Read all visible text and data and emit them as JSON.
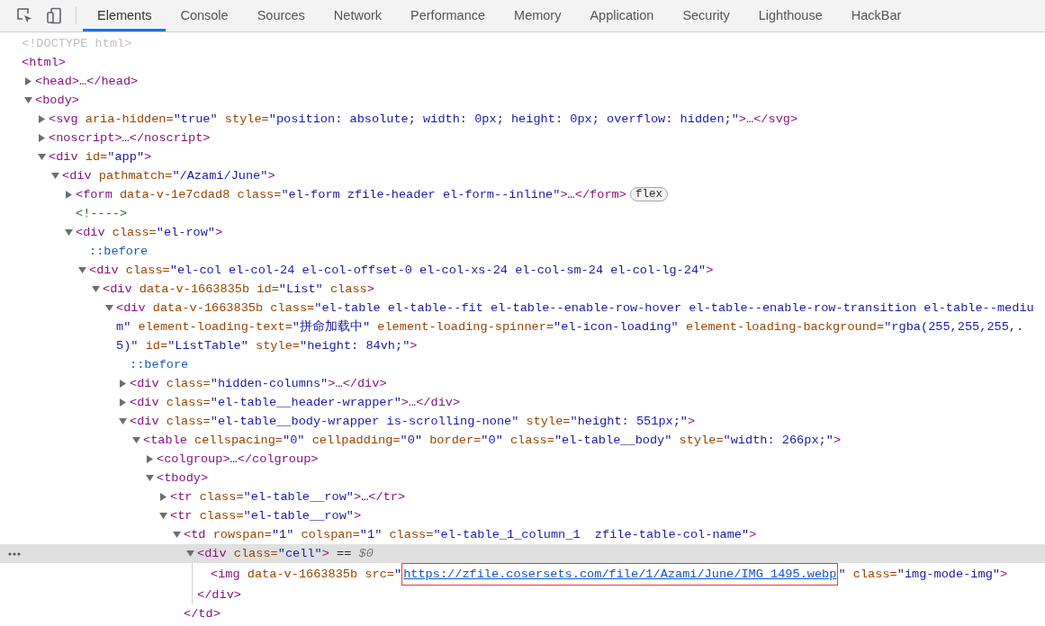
{
  "toolbar": {
    "tabs": [
      {
        "label": "Elements",
        "selected": true
      },
      {
        "label": "Console",
        "selected": false
      },
      {
        "label": "Sources",
        "selected": false
      },
      {
        "label": "Network",
        "selected": false
      },
      {
        "label": "Performance",
        "selected": false
      },
      {
        "label": "Memory",
        "selected": false
      },
      {
        "label": "Application",
        "selected": false
      },
      {
        "label": "Security",
        "selected": false
      },
      {
        "label": "Lighthouse",
        "selected": false
      },
      {
        "label": "HackBar",
        "selected": false
      }
    ]
  },
  "dom_tree": [
    {
      "selected": false,
      "tokens": [
        {
          "kind": "doctype",
          "text": "<!DOCTYPE html>"
        }
      ]
    },
    {
      "selected": false,
      "tokens": [
        {
          "kind": "tag",
          "text": "<html>"
        }
      ],
      "children": [
        {
          "selected": false,
          "expanded": false,
          "tokens": [
            {
              "kind": "tag",
              "text": "<head>"
            },
            {
              "kind": "plain",
              "text": "…"
            },
            {
              "kind": "tag",
              "text": "</head>"
            }
          ]
        },
        {
          "selected": false,
          "expanded": true,
          "tokens": [
            {
              "kind": "tag",
              "text": "<body>"
            }
          ],
          "children": [
            {
              "selected": false,
              "expanded": false,
              "tokens": [
                {
                  "kind": "tag",
                  "text": "<svg"
                },
                {
                  "kind": "attr",
                  "text": " aria-hidden="
                },
                {
                  "kind": "value",
                  "text": "\"true\""
                },
                {
                  "kind": "attr",
                  "text": " style="
                },
                {
                  "kind": "value",
                  "text": "\"position: absolute; width: 0px; height: 0px; overflow: hidden;\""
                },
                {
                  "kind": "tag",
                  "text": ">"
                },
                {
                  "kind": "plain",
                  "text": "…"
                },
                {
                  "kind": "tag",
                  "text": "</svg>"
                }
              ]
            },
            {
              "selected": false,
              "expanded": false,
              "tokens": [
                {
                  "kind": "tag",
                  "text": "<noscript>"
                },
                {
                  "kind": "plain",
                  "text": "…"
                },
                {
                  "kind": "tag",
                  "text": "</noscript>"
                }
              ]
            },
            {
              "selected": false,
              "expanded": true,
              "tokens": [
                {
                  "kind": "tag",
                  "text": "<div"
                },
                {
                  "kind": "attr",
                  "text": " id="
                },
                {
                  "kind": "value",
                  "text": "\"app\""
                },
                {
                  "kind": "tag",
                  "text": ">"
                }
              ],
              "children": [
                {
                  "selected": false,
                  "expanded": true,
                  "tokens": [
                    {
                      "kind": "tag",
                      "text": "<div"
                    },
                    {
                      "kind": "attr",
                      "text": " pathmatch="
                    },
                    {
                      "kind": "value",
                      "text": "\"/Azami/June\""
                    },
                    {
                      "kind": "tag",
                      "text": ">"
                    }
                  ],
                  "children": [
                    {
                      "selected": false,
                      "expanded": false,
                      "badge": "flex",
                      "tokens": [
                        {
                          "kind": "tag",
                          "text": "<form"
                        },
                        {
                          "kind": "attr",
                          "text": " data-v-1e7cdad8"
                        },
                        {
                          "kind": "attr",
                          "text": " class="
                        },
                        {
                          "kind": "value",
                          "text": "\"el-form zfile-header el-form--inline\""
                        },
                        {
                          "kind": "tag",
                          "text": ">"
                        },
                        {
                          "kind": "plain",
                          "text": "…"
                        },
                        {
                          "kind": "tag",
                          "text": "</form>"
                        }
                      ]
                    },
                    {
                      "selected": false,
                      "tokens": [
                        {
                          "kind": "comment",
                          "text": "<!---->"
                        }
                      ]
                    },
                    {
                      "selected": false,
                      "expanded": true,
                      "tokens": [
                        {
                          "kind": "tag",
                          "text": "<div"
                        },
                        {
                          "kind": "attr",
                          "text": " class="
                        },
                        {
                          "kind": "value",
                          "text": "\"el-row\""
                        },
                        {
                          "kind": "tag",
                          "text": ">"
                        }
                      ],
                      "children": [
                        {
                          "selected": false,
                          "tokens": [
                            {
                              "kind": "pseudo",
                              "text": "::before"
                            }
                          ]
                        },
                        {
                          "selected": false,
                          "expanded": true,
                          "tokens": [
                            {
                              "kind": "tag",
                              "text": "<div"
                            },
                            {
                              "kind": "attr",
                              "text": " class="
                            },
                            {
                              "kind": "value",
                              "text": "\"el-col el-col-24 el-col-offset-0 el-col-xs-24 el-col-sm-24 el-col-lg-24\""
                            },
                            {
                              "kind": "tag",
                              "text": ">"
                            }
                          ],
                          "children": [
                            {
                              "selected": false,
                              "expanded": true,
                              "tokens": [
                                {
                                  "kind": "tag",
                                  "text": "<div"
                                },
                                {
                                  "kind": "attr",
                                  "text": " data-v-1663835b"
                                },
                                {
                                  "kind": "attr",
                                  "text": " id="
                                },
                                {
                                  "kind": "value",
                                  "text": "\"List\""
                                },
                                {
                                  "kind": "attr",
                                  "text": " class"
                                },
                                {
                                  "kind": "tag",
                                  "text": ">"
                                }
                              ],
                              "children": [
                                {
                                  "selected": false,
                                  "expanded": true,
                                  "tokens": [
                                    {
                                      "kind": "tag",
                                      "text": "<div"
                                    },
                                    {
                                      "kind": "attr",
                                      "text": " data-v-1663835b"
                                    },
                                    {
                                      "kind": "attr",
                                      "text": " class="
                                    },
                                    {
                                      "kind": "value",
                                      "text": "\"el-table el-table--fit el-table--enable-row-hover el-table--enable-row-transition el-table--medium\""
                                    },
                                    {
                                      "kind": "attr",
                                      "text": " element-loading-text="
                                    },
                                    {
                                      "kind": "value",
                                      "text": "\"拼命加载中\""
                                    },
                                    {
                                      "kind": "attr",
                                      "text": " element-loading-spinner="
                                    },
                                    {
                                      "kind": "value",
                                      "text": "\"el-icon-loading\""
                                    },
                                    {
                                      "kind": "attr",
                                      "text": " element-loading-background="
                                    },
                                    {
                                      "kind": "value",
                                      "text": "\"rgba(255,255,255,.5)\""
                                    },
                                    {
                                      "kind": "attr",
                                      "text": " id="
                                    },
                                    {
                                      "kind": "value",
                                      "text": "\"ListTable\""
                                    },
                                    {
                                      "kind": "attr",
                                      "text": " style="
                                    },
                                    {
                                      "kind": "value",
                                      "text": "\"height: 84vh;\""
                                    },
                                    {
                                      "kind": "tag",
                                      "text": ">"
                                    }
                                  ],
                                  "children": [
                                    {
                                      "selected": false,
                                      "tokens": [
                                        {
                                          "kind": "pseudo",
                                          "text": "::before"
                                        }
                                      ]
                                    },
                                    {
                                      "selected": false,
                                      "expanded": false,
                                      "tokens": [
                                        {
                                          "kind": "tag",
                                          "text": "<div"
                                        },
                                        {
                                          "kind": "attr",
                                          "text": " class="
                                        },
                                        {
                                          "kind": "value",
                                          "text": "\"hidden-columns\""
                                        },
                                        {
                                          "kind": "tag",
                                          "text": ">"
                                        },
                                        {
                                          "kind": "plain",
                                          "text": "…"
                                        },
                                        {
                                          "kind": "tag",
                                          "text": "</div>"
                                        }
                                      ]
                                    },
                                    {
                                      "selected": false,
                                      "expanded": false,
                                      "tokens": [
                                        {
                                          "kind": "tag",
                                          "text": "<div"
                                        },
                                        {
                                          "kind": "attr",
                                          "text": " class="
                                        },
                                        {
                                          "kind": "value",
                                          "text": "\"el-table__header-wrapper\""
                                        },
                                        {
                                          "kind": "tag",
                                          "text": ">"
                                        },
                                        {
                                          "kind": "plain",
                                          "text": "…"
                                        },
                                        {
                                          "kind": "tag",
                                          "text": "</div>"
                                        }
                                      ]
                                    },
                                    {
                                      "selected": false,
                                      "expanded": true,
                                      "tokens": [
                                        {
                                          "kind": "tag",
                                          "text": "<div"
                                        },
                                        {
                                          "kind": "attr",
                                          "text": " class="
                                        },
                                        {
                                          "kind": "value",
                                          "text": "\"el-table__body-wrapper is-scrolling-none\""
                                        },
                                        {
                                          "kind": "attr",
                                          "text": " style="
                                        },
                                        {
                                          "kind": "value",
                                          "text": "\"height: 551px;\""
                                        },
                                        {
                                          "kind": "tag",
                                          "text": ">"
                                        }
                                      ],
                                      "children": [
                                        {
                                          "selected": false,
                                          "expanded": true,
                                          "tokens": [
                                            {
                                              "kind": "tag",
                                              "text": "<table"
                                            },
                                            {
                                              "kind": "attr",
                                              "text": " cellspacing="
                                            },
                                            {
                                              "kind": "value",
                                              "text": "\"0\""
                                            },
                                            {
                                              "kind": "attr",
                                              "text": " cellpadding="
                                            },
                                            {
                                              "kind": "value",
                                              "text": "\"0\""
                                            },
                                            {
                                              "kind": "attr",
                                              "text": " border="
                                            },
                                            {
                                              "kind": "value",
                                              "text": "\"0\""
                                            },
                                            {
                                              "kind": "attr",
                                              "text": " class="
                                            },
                                            {
                                              "kind": "value",
                                              "text": "\"el-table__body\""
                                            },
                                            {
                                              "kind": "attr",
                                              "text": " style="
                                            },
                                            {
                                              "kind": "value",
                                              "text": "\"width: 266px;\""
                                            },
                                            {
                                              "kind": "tag",
                                              "text": ">"
                                            }
                                          ],
                                          "children": [
                                            {
                                              "selected": false,
                                              "expanded": false,
                                              "tokens": [
                                                {
                                                  "kind": "tag",
                                                  "text": "<colgroup>"
                                                },
                                                {
                                                  "kind": "plain",
                                                  "text": "…"
                                                },
                                                {
                                                  "kind": "tag",
                                                  "text": "</colgroup>"
                                                }
                                              ]
                                            },
                                            {
                                              "selected": false,
                                              "expanded": true,
                                              "tokens": [
                                                {
                                                  "kind": "tag",
                                                  "text": "<tbody>"
                                                }
                                              ],
                                              "children": [
                                                {
                                                  "selected": false,
                                                  "expanded": false,
                                                  "tokens": [
                                                    {
                                                      "kind": "tag",
                                                      "text": "<tr"
                                                    },
                                                    {
                                                      "kind": "attr",
                                                      "text": " class="
                                                    },
                                                    {
                                                      "kind": "value",
                                                      "text": "\"el-table__row\""
                                                    },
                                                    {
                                                      "kind": "tag",
                                                      "text": ">"
                                                    },
                                                    {
                                                      "kind": "plain",
                                                      "text": "…"
                                                    },
                                                    {
                                                      "kind": "tag",
                                                      "text": "</tr>"
                                                    }
                                                  ]
                                                },
                                                {
                                                  "selected": false,
                                                  "expanded": true,
                                                  "tokens": [
                                                    {
                                                      "kind": "tag",
                                                      "text": "<tr"
                                                    },
                                                    {
                                                      "kind": "attr",
                                                      "text": " class="
                                                    },
                                                    {
                                                      "kind": "value",
                                                      "text": "\"el-table__row\""
                                                    },
                                                    {
                                                      "kind": "tag",
                                                      "text": ">"
                                                    }
                                                  ],
                                                  "children": [
                                                    {
                                                      "selected": false,
                                                      "expanded": true,
                                                      "closing": "</td>",
                                                      "tokens": [
                                                        {
                                                          "kind": "tag",
                                                          "text": "<td"
                                                        },
                                                        {
                                                          "kind": "attr",
                                                          "text": " rowspan="
                                                        },
                                                        {
                                                          "kind": "value",
                                                          "text": "\"1\""
                                                        },
                                                        {
                                                          "kind": "attr",
                                                          "text": " colspan="
                                                        },
                                                        {
                                                          "kind": "value",
                                                          "text": "\"1\""
                                                        },
                                                        {
                                                          "kind": "attr",
                                                          "text": " class="
                                                        },
                                                        {
                                                          "kind": "value",
                                                          "text": "\"el-table_1_column_1  zfile-table-col-name\""
                                                        },
                                                        {
                                                          "kind": "tag",
                                                          "text": ">"
                                                        }
                                                      ],
                                                      "children": [
                                                        {
                                                          "selected": true,
                                                          "expanded": true,
                                                          "closing": "</div>",
                                                          "tokens": [
                                                            {
                                                              "kind": "tag",
                                                              "text": "<div"
                                                            },
                                                            {
                                                              "kind": "attr",
                                                              "text": " class="
                                                            },
                                                            {
                                                              "kind": "value",
                                                              "text": "\"cell\""
                                                            },
                                                            {
                                                              "kind": "tag",
                                                              "text": ">"
                                                            },
                                                            {
                                                              "kind": "plain",
                                                              "text": " == "
                                                            },
                                                            {
                                                              "kind": "ref",
                                                              "text": "$0"
                                                            }
                                                          ],
                                                          "children": [
                                                            {
                                                              "selected": false,
                                                              "tokens": [
                                                                {
                                                                  "kind": "tag",
                                                                  "text": "<img"
                                                                },
                                                                {
                                                                  "kind": "attr",
                                                                  "text": " data-v-1663835b"
                                                                },
                                                                {
                                                                  "kind": "attr",
                                                                  "text": " src="
                                                                },
                                                                {
                                                                  "kind": "value",
                                                                  "text": "\""
                                                                },
                                                                {
                                                                  "kind": "marked_link",
                                                                  "text": "https://zfile.cosersets.com/file/1/Azami/June/IMG_1495.webp"
                                                                },
                                                                {
                                                                  "kind": "value",
                                                                  "text": "\""
                                                                },
                                                                {
                                                                  "kind": "attr",
                                                                  "text": " class="
                                                                },
                                                                {
                                                                  "kind": "value",
                                                                  "text": "\"img-mode-img\""
                                                                },
                                                                {
                                                                  "kind": "tag",
                                                                  "text": ">"
                                                                }
                                                              ]
                                                            }
                                                          ]
                                                        }
                                                      ]
                                                    }
                                                  ]
                                                }
                                              ]
                                            }
                                          ]
                                        }
                                      ]
                                    }
                                  ]
                                }
                              ]
                            }
                          ]
                        }
                      ]
                    }
                  ]
                }
              ]
            }
          ]
        }
      ]
    }
  ]
}
